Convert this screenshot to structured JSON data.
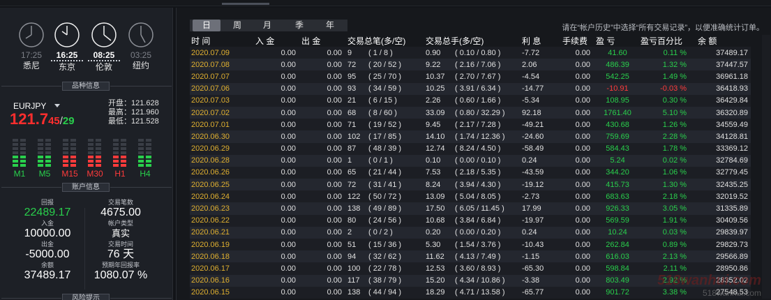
{
  "clocks": [
    {
      "time": "17:25",
      "city": "悉尼",
      "active": false
    },
    {
      "time": "16:25",
      "city": "东京",
      "active": true
    },
    {
      "time": "08:25",
      "city": "伦敦",
      "active": true
    },
    {
      "time": "03:25",
      "city": "纽约",
      "active": false
    }
  ],
  "symbol_section": {
    "title": "品种信息",
    "symbol": "EURJPY",
    "price_main": "121.7",
    "price_bid": "45",
    "price_sep": "/",
    "price_ask": "29",
    "open_label": "开盘：",
    "open": "121.628",
    "high_label": "最高：",
    "high": "121.960",
    "low_label": "最低：",
    "low": "121.528",
    "timeframes": [
      {
        "label": "M1",
        "color": "#29cf4c"
      },
      {
        "label": "M5",
        "color": "#29cf4c"
      },
      {
        "label": "M15",
        "color": "#ff3b3b"
      },
      {
        "label": "M30",
        "color": "#ff3b3b"
      },
      {
        "label": "H1",
        "color": "#ff3b3b"
      },
      {
        "label": "H4",
        "color": "#29cf4c"
      }
    ]
  },
  "account": {
    "title": "账户信息",
    "return_label": "回报",
    "return_value": "22489.17",
    "trades_label": "交易笔数",
    "trades_value": "4675.00",
    "deposit_label": "入金",
    "deposit_value": "10000.00",
    "type_label": "帐户类型",
    "type_value": "真实",
    "withdraw_label": "出金",
    "withdraw_value": "-5000.00",
    "time_label": "交易时间",
    "time_value": "76 天",
    "balance_label": "余额",
    "balance_value": "37489.17",
    "annual_label": "预期年回报率",
    "annual_value": "1080.07 %"
  },
  "bottom_section": {
    "title": "风险提示"
  },
  "tabs": [
    "日",
    "周",
    "月",
    "季",
    "年"
  ],
  "hint": "请在“帐户历史”中选择“所有交易记录”，以便准确统计订单。",
  "columns": [
    "时 间",
    "入 金",
    "出 金",
    "交易总笔(多/空)",
    "交易总手(多/空)",
    "利 息",
    "手续费",
    "盈 亏",
    "盈亏百分比",
    "余 额"
  ],
  "rows": [
    [
      "2020.07.09",
      "0.00",
      "0.00",
      "9",
      "( 1 / 8 )",
      "0.90",
      "( 0.10 / 0.80 )",
      "-7.72",
      "0.00",
      "41.60",
      "0.11 %",
      "37489.17"
    ],
    [
      "2020.07.08",
      "0.00",
      "0.00",
      "72",
      "( 20 / 52 )",
      "9.22",
      "( 2.16 / 7.06 )",
      "2.06",
      "0.00",
      "486.39",
      "1.32 %",
      "37447.57"
    ],
    [
      "2020.07.07",
      "0.00",
      "0.00",
      "95",
      "( 25 / 70 )",
      "10.37",
      "( 2.70 / 7.67 )",
      "-4.54",
      "0.00",
      "542.25",
      "1.49 %",
      "36961.18"
    ],
    [
      "2020.07.06",
      "0.00",
      "0.00",
      "93",
      "( 34 / 59 )",
      "10.25",
      "( 3.91 / 6.34 )",
      "-14.77",
      "0.00",
      "-10.91",
      "-0.03 %",
      "36418.93"
    ],
    [
      "2020.07.03",
      "0.00",
      "0.00",
      "21",
      "( 6 / 15 )",
      "2.26",
      "( 0.60 / 1.66 )",
      "-5.34",
      "0.00",
      "108.95",
      "0.30 %",
      "36429.84"
    ],
    [
      "2020.07.02",
      "0.00",
      "0.00",
      "68",
      "( 8 / 60 )",
      "33.09",
      "( 0.80 / 32.29 )",
      "92.18",
      "0.00",
      "1761.40",
      "5.10 %",
      "36320.89"
    ],
    [
      "2020.07.01",
      "0.00",
      "0.00",
      "71",
      "( 19 / 52 )",
      "9.45",
      "( 2.17 / 7.28 )",
      "-49.21",
      "0.00",
      "430.68",
      "1.26 %",
      "34559.49"
    ],
    [
      "2020.06.30",
      "0.00",
      "0.00",
      "102",
      "( 17 / 85 )",
      "14.10",
      "( 1.74 / 12.36 )",
      "-24.60",
      "0.00",
      "759.69",
      "2.28 %",
      "34128.81"
    ],
    [
      "2020.06.29",
      "0.00",
      "0.00",
      "87",
      "( 48 / 39 )",
      "12.74",
      "( 8.24 / 4.50 )",
      "-58.49",
      "0.00",
      "584.43",
      "1.78 %",
      "33369.12"
    ],
    [
      "2020.06.28",
      "0.00",
      "0.00",
      "1",
      "( 0 / 1 )",
      "0.10",
      "( 0.00 / 0.10 )",
      "0.24",
      "0.00",
      "5.24",
      "0.02 %",
      "32784.69"
    ],
    [
      "2020.06.26",
      "0.00",
      "0.00",
      "65",
      "( 21 / 44 )",
      "7.53",
      "( 2.18 / 5.35 )",
      "-43.59",
      "0.00",
      "344.20",
      "1.06 %",
      "32779.45"
    ],
    [
      "2020.06.25",
      "0.00",
      "0.00",
      "72",
      "( 31 / 41 )",
      "8.24",
      "( 3.94 / 4.30 )",
      "-19.12",
      "0.00",
      "415.73",
      "1.30 %",
      "32435.25"
    ],
    [
      "2020.06.24",
      "0.00",
      "0.00",
      "122",
      "( 50 / 72 )",
      "13.09",
      "( 5.04 / 8.05 )",
      "-2.73",
      "0.00",
      "683.63",
      "2.18 %",
      "32019.52"
    ],
    [
      "2020.06.23",
      "0.00",
      "0.00",
      "138",
      "( 49 / 89 )",
      "17.50",
      "( 6.05 / 11.45 )",
      "17.99",
      "0.00",
      "926.33",
      "3.05 %",
      "31335.89"
    ],
    [
      "2020.06.22",
      "0.00",
      "0.00",
      "80",
      "( 24 / 56 )",
      "10.68",
      "( 3.84 / 6.84 )",
      "-19.97",
      "0.00",
      "569.59",
      "1.91 %",
      "30409.56"
    ],
    [
      "2020.06.21",
      "0.00",
      "0.00",
      "2",
      "( 0 / 2 )",
      "0.20",
      "( 0.00 / 0.20 )",
      "0.24",
      "0.00",
      "10.24",
      "0.03 %",
      "29839.97"
    ],
    [
      "2020.06.19",
      "0.00",
      "0.00",
      "51",
      "( 15 / 36 )",
      "5.30",
      "( 1.54 / 3.76 )",
      "-10.43",
      "0.00",
      "262.84",
      "0.89 %",
      "29829.73"
    ],
    [
      "2020.06.18",
      "0.00",
      "0.00",
      "94",
      "( 32 / 62 )",
      "11.62",
      "( 4.13 / 7.49 )",
      "-1.15",
      "0.00",
      "616.03",
      "2.13 %",
      "29566.89"
    ],
    [
      "2020.06.17",
      "0.00",
      "0.00",
      "100",
      "( 22 / 78 )",
      "12.53",
      "( 3.60 / 8.93 )",
      "-65.30",
      "0.00",
      "598.84",
      "2.11 %",
      "28950.86"
    ],
    [
      "2020.06.16",
      "0.00",
      "0.00",
      "117",
      "( 38 / 79 )",
      "15.20",
      "( 4.34 / 10.86 )",
      "-3.38",
      "0.00",
      "803.49",
      "2.92 %",
      "28352.02"
    ],
    [
      "2020.06.15",
      "0.00",
      "0.00",
      "138",
      "( 44 / 94 )",
      "18.29",
      "( 4.71 / 13.58 )",
      "-65.77",
      "0.00",
      "901.72",
      "3.38 %",
      "27548.53"
    ]
  ],
  "watermark": "518wanhui.com",
  "watermark2": "518wanhui.com",
  "colors": {
    "green": "#29cf4c",
    "red": "#ff3b3b",
    "date": "#e0b030"
  }
}
